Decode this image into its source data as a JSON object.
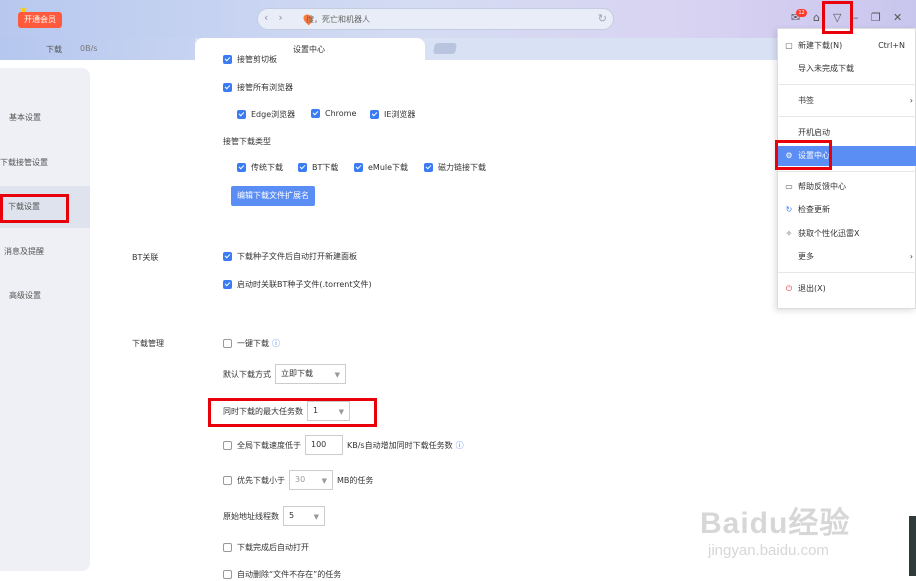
{
  "titlebar": {
    "vip_label": "开通会员",
    "search_placeholder": "搜，死亡和机器人",
    "notification_count": "12"
  },
  "tabs": {
    "download_label": "下载",
    "download_speed": "0B/s",
    "settings_label": "设置中心"
  },
  "sidebar": {
    "items": [
      {
        "label": "基本设置"
      },
      {
        "label": "下载接管设置"
      },
      {
        "label": "下载设置"
      },
      {
        "label": "消息及提醒"
      },
      {
        "label": "高级设置"
      }
    ]
  },
  "takeover": {
    "clipboard_partial": "接管剪切板",
    "all_browsers": "接管所有浏览器",
    "browsers": [
      "Edge浏览器",
      "Chrome",
      "IE浏览器"
    ],
    "types_heading": "接管下载类型",
    "types": [
      "传统下载",
      "BT下载",
      "eMule下载",
      "磁力链接下载"
    ],
    "edit_ext_button": "编辑下载文件扩展名"
  },
  "bt": {
    "section_label": "BT关联",
    "open_panel": "下载种子文件后自动打开新建面板",
    "associate_torrent": "启动时关联BT种子文件(.torrent文件)"
  },
  "download_mgmt": {
    "section_label": "下载管理",
    "one_click": "一键下载",
    "default_mode_label": "默认下载方式",
    "default_mode_value": "立即下载",
    "max_tasks_label": "同时下载的最大任务数",
    "max_tasks_value": "1",
    "speed_prefix": "全局下载速度低于",
    "speed_value": "100",
    "speed_suffix": "KB/s自动增加同时下载任务数",
    "small_prefix": "优先下载小于",
    "small_value": "30",
    "small_suffix": "MB的任务",
    "threads_label": "原始地址线程数",
    "threads_value": "5",
    "auto_open": "下载完成后自动打开",
    "auto_delete": "自动删除“文件不存在”的任务"
  },
  "menu": {
    "items": [
      {
        "label": "新建下载(N)",
        "shortcut": "Ctrl+N",
        "icon": "new-file-icon"
      },
      {
        "label": "导入未完成下载",
        "icon": ""
      },
      {
        "label": "书签",
        "icon": ""
      },
      {
        "label": "开机启动",
        "icon": ""
      },
      {
        "label": "设置中心",
        "icon": "gear-icon"
      },
      {
        "label": "帮助反馈中心",
        "icon": "chat-icon"
      },
      {
        "label": "检查更新",
        "icon": "refresh-icon"
      },
      {
        "label": "获取个性化迅雷X",
        "icon": "magic-icon"
      },
      {
        "label": "更多",
        "icon": ""
      },
      {
        "label": "退出(X)",
        "icon": "power-icon"
      }
    ]
  },
  "watermark": {
    "main": "Baidu经验",
    "sub": "jingyan.baidu.com"
  },
  "colors": {
    "accent": "#5b8ef5",
    "checkbox": "#3b7cf5",
    "annotation_red": "#e8000b",
    "vip_badge": "#ff5a3c"
  }
}
